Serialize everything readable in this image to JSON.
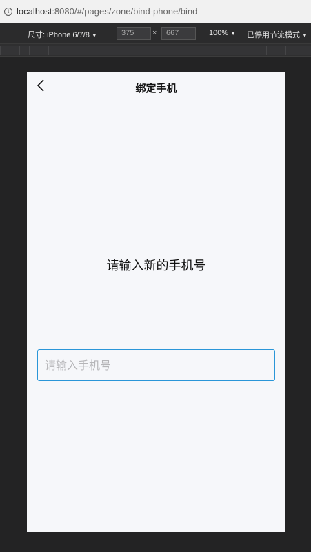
{
  "browser": {
    "url_host": "localhost",
    "url_rest": ":8080/#/pages/zone/bind-phone/bind"
  },
  "devtools": {
    "device_label": "尺寸: iPhone 6/7/8",
    "width": "375",
    "height": "667",
    "times": "×",
    "zoom": "100%",
    "throttle": "已停用节流模式"
  },
  "page": {
    "nav_title": "绑定手机",
    "prompt": "请输入新的手机号",
    "phone_input": {
      "value": "",
      "placeholder": "请输入手机号"
    }
  },
  "colors": {
    "input_border": "#2a96d8",
    "page_bg": "#f6f7fa"
  }
}
